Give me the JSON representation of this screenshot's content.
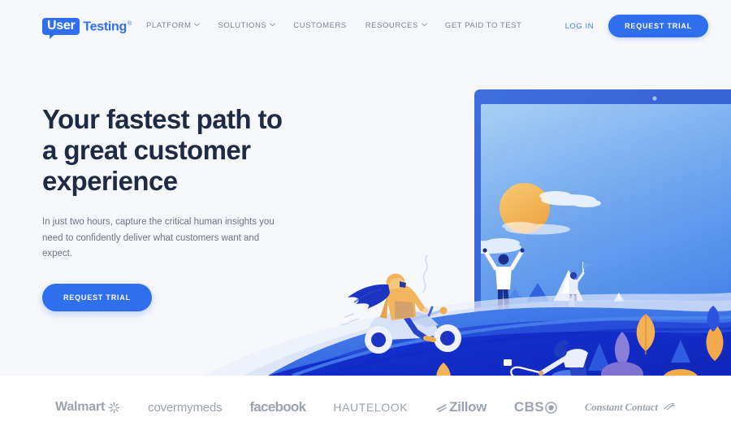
{
  "brand": {
    "logo_primary": "User",
    "logo_secondary": "Testing",
    "logo_registered": "®",
    "accent_blue": "#2f6fed",
    "deep_blue": "#1433d4",
    "headline_navy": "#1f2a44",
    "page_bg": "#f7f8fc",
    "sun_orange": "#f0ad4e"
  },
  "header": {
    "nav": [
      {
        "label": "PLATFORM",
        "has_dropdown": true
      },
      {
        "label": "SOLUTIONS",
        "has_dropdown": true
      },
      {
        "label": "CUSTOMERS",
        "has_dropdown": false
      },
      {
        "label": "RESOURCES",
        "has_dropdown": true
      },
      {
        "label": "GET PAID TO TEST",
        "has_dropdown": false
      }
    ],
    "login_label": "LOG IN",
    "cta_label": "REQUEST TRIAL"
  },
  "hero": {
    "headline_line1": "Your fastest path to",
    "headline_line2": "a great customer",
    "headline_line3": "experience",
    "subhead": "In just two hours, capture the critical human insights you need to confidently deliver what customers want and expect.",
    "cta_label": "REQUEST TRIAL"
  },
  "clients": [
    {
      "name": "Walmart",
      "mark": "spark-icon"
    },
    {
      "name": "covermymeds",
      "mark": ""
    },
    {
      "name": "facebook",
      "mark": ""
    },
    {
      "name": "HAUTELOOK",
      "mark": ""
    },
    {
      "name": "Zillow",
      "mark": "zillow-swoosh-icon"
    },
    {
      "name": "CBS",
      "mark": "cbs-eye-icon"
    },
    {
      "name": "Constant Contact",
      "mark": "constant-contact-icon"
    }
  ]
}
